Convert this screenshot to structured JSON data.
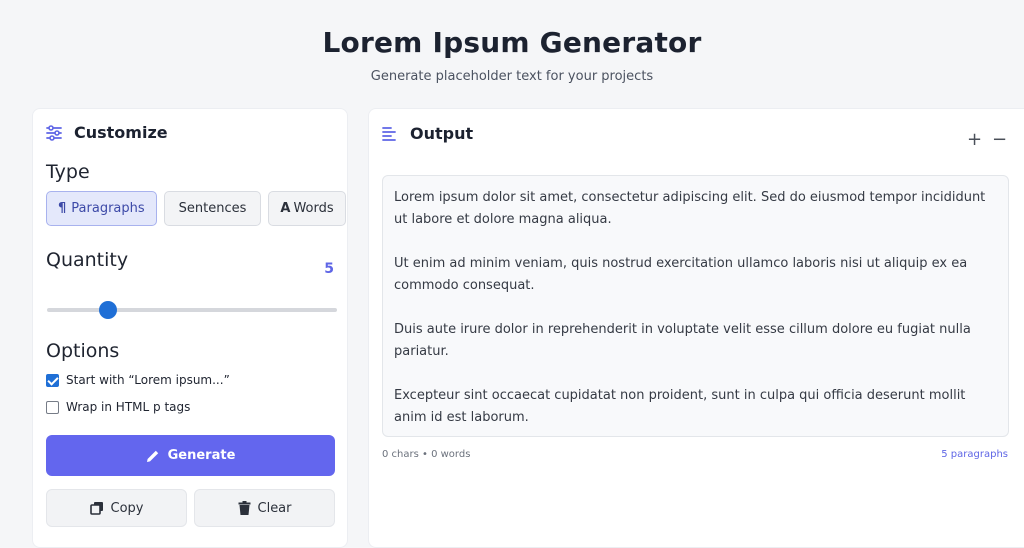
{
  "header": {
    "title": "Lorem Ipsum Generator",
    "subtitle": "Generate placeholder text for your projects"
  },
  "customize": {
    "title": "Customize",
    "type_label": "Type",
    "types": [
      {
        "label": "Paragraphs",
        "icon": "pilcrow-icon",
        "active": true
      },
      {
        "label": "Sentences",
        "icon": "",
        "active": false
      },
      {
        "label": "Words",
        "icon": "font-icon",
        "active": false
      }
    ],
    "quantity_label": "Quantity",
    "quantity_value": "5",
    "slider": {
      "min": 1,
      "max": 20,
      "value": 5
    },
    "options_label": "Options",
    "options": [
      {
        "label": "Start with “Lorem ipsum...”",
        "checked": true
      },
      {
        "label": "Wrap in HTML p tags",
        "checked": false
      }
    ],
    "generate_label": "Generate",
    "copy_label": "Copy",
    "clear_label": "Clear"
  },
  "output": {
    "title": "Output",
    "zoom_in": "+",
    "zoom_out": "−",
    "paragraphs": [
      "Lorem ipsum dolor sit amet, consectetur adipiscing elit. Sed do eiusmod tempor incididunt ut labore et dolore magna aliqua.",
      "Ut enim ad minim veniam, quis nostrud exercitation ullamco laboris nisi ut aliquip ex ea commodo consequat.",
      "Duis aute irure dolor in reprehenderit in voluptate velit esse cillum dolore eu fugiat nulla pariatur.",
      "Excepteur sint occaecat cupidatat non proident, sunt in culpa qui officia deserunt mollit anim id est laborum."
    ],
    "stats": "0 chars • 0 words",
    "paragraph_count": "5 paragraphs"
  },
  "colors": {
    "accent": "#6366ee",
    "slider_thumb": "#1f6fd6",
    "background": "#f5f6f8"
  }
}
